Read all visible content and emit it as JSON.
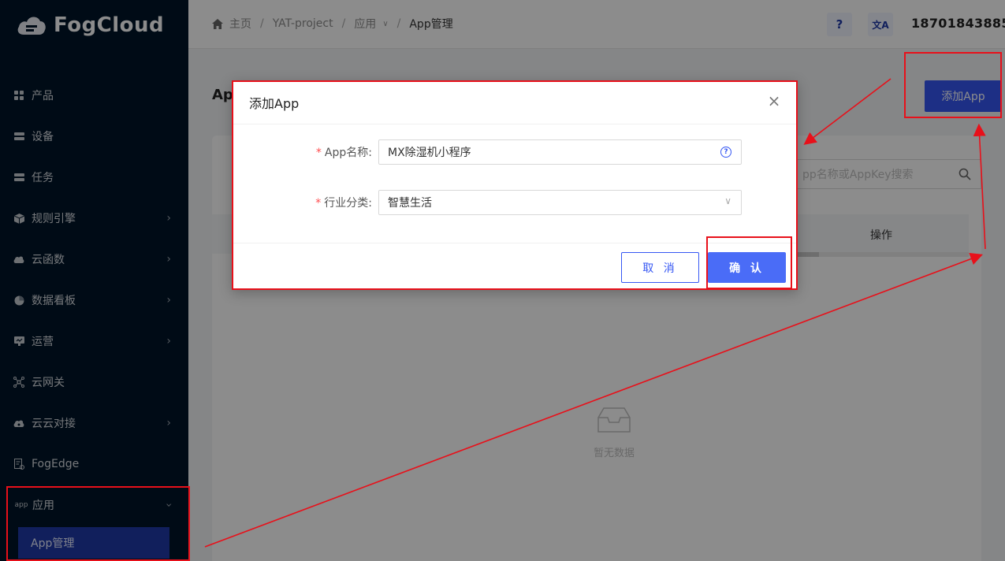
{
  "sidebar": {
    "logo_text": "FogCloud",
    "items": [
      {
        "label": "产品",
        "icon": "grid-icon",
        "has_arrow": false
      },
      {
        "label": "设备",
        "icon": "device-icon",
        "has_arrow": false
      },
      {
        "label": "任务",
        "icon": "task-icon",
        "has_arrow": false
      },
      {
        "label": "规则引擎",
        "icon": "cube-icon",
        "has_arrow": true
      },
      {
        "label": "云函数",
        "icon": "cloud-icon",
        "has_arrow": true
      },
      {
        "label": "数据看板",
        "icon": "pie-chart-icon",
        "has_arrow": true
      },
      {
        "label": "运营",
        "icon": "board-icon",
        "has_arrow": true
      },
      {
        "label": "云网关",
        "icon": "network-icon",
        "has_arrow": false
      },
      {
        "label": "云云对接",
        "icon": "cloud-link-icon",
        "has_arrow": true
      },
      {
        "label": "FogEdge",
        "icon": "edge-icon",
        "has_arrow": false
      },
      {
        "label": "应用",
        "icon": "app-icon",
        "icon_text": "app",
        "has_arrow": true,
        "open": true
      }
    ],
    "active_sub_item": "App管理"
  },
  "header": {
    "breadcrumb": [
      "主页",
      "YAT-project",
      "应用",
      "App管理"
    ],
    "help_label": "?",
    "lang_label": "文A",
    "user": "18701843885"
  },
  "main": {
    "page_title": "Ap",
    "add_button": "添加App",
    "search_placeholder": "pp名称或AppKey搜索",
    "column_operation": "操作",
    "empty_text": "暂无数据"
  },
  "modal": {
    "title": "添加App",
    "close": "×",
    "fields": {
      "name_label": "App名称:",
      "name_value": "MX除湿机小程序",
      "industry_label": "行业分类:",
      "industry_value": "智慧生活"
    },
    "cancel_label": "取 消",
    "ok_label": "确 认"
  },
  "colors": {
    "sidebar_bg": "#001529",
    "primary": "#3657f3",
    "annotation": "#e8101a"
  }
}
